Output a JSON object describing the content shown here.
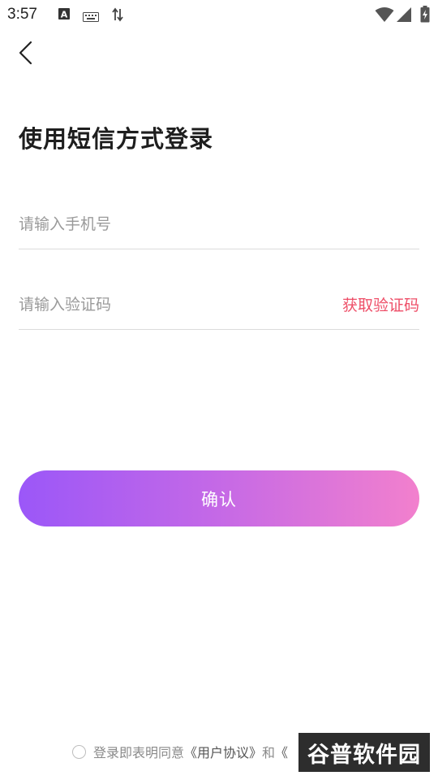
{
  "status_bar": {
    "time": "3:57",
    "icons": [
      "keyboard-a-icon",
      "keyboard-icon",
      "data-transfer-icon",
      "wifi-icon",
      "signal-icon",
      "battery-charging-icon"
    ]
  },
  "header": {
    "back_icon": "chevron-left-icon",
    "title": "使用短信方式登录"
  },
  "form": {
    "phone": {
      "value": "",
      "placeholder": "请输入手机号"
    },
    "code": {
      "value": "",
      "placeholder": "请输入验证码",
      "get_code_label": "获取验证码"
    },
    "confirm_label": "确认"
  },
  "agreement": {
    "prefix": "登录即表明同意",
    "user_agreement": "《用户协议》",
    "conjunction": "和",
    "privacy_policy": "《"
  },
  "watermark": {
    "brand": "谷普软件园"
  },
  "colors": {
    "accent": "#ee4f68",
    "button_gradient_start": "#9b57f8",
    "button_gradient_end": "#f280cd"
  }
}
